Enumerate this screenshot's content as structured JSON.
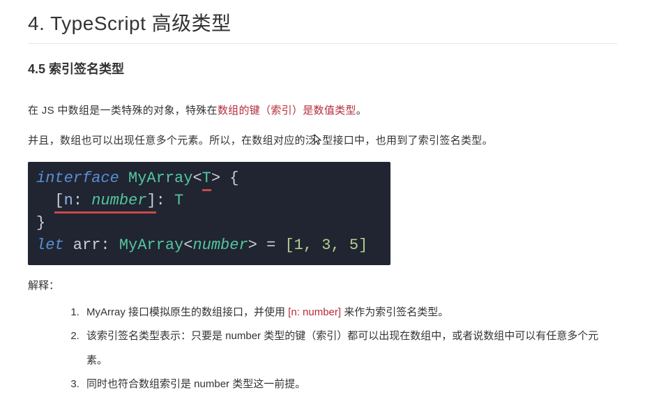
{
  "h1": "4. TypeScript 高级类型",
  "h2": "4.5 索引签名类型",
  "p1_a": "在 JS 中数组是一类特殊的对象，特殊在",
  "p1_em": "数组的键（索引）是数值类型",
  "p1_b": "。",
  "p2_a": "并且，数组也可以出现任意多个元素。所以，在数组对应的泛",
  "p2_b": "型接口中，也用到了索引签名类型。",
  "code": {
    "l1": {
      "kw": "interface",
      "name": "MyArray",
      "lt": "<",
      "tp": "T",
      "gt": ">",
      "brace": " {"
    },
    "l2": {
      "indent": "  ",
      "lb": "[",
      "k": "n",
      "colon1": ": ",
      "kt": "number",
      "rb": "]",
      "colon2": ": ",
      "vt": "T"
    },
    "l3": {
      "brace": "}"
    },
    "l4": {
      "kw": "let",
      "var": " arr",
      "colon": ": ",
      "t1": "MyArray",
      "lt": "<",
      "inner": "number",
      "gt": ">",
      "eq": " = ",
      "arr": "[1, 3, 5]"
    }
  },
  "explain_label": "解释：",
  "items": [
    {
      "a": "MyArray 接口模拟原生的数组接口，并使用 ",
      "code": "[n: number]",
      "b": " 来作为索引签名类型。"
    },
    {
      "a": "该索引签名类型表示：只要是 number 类型的键（索引）都可以出现在数组中，或者说数组中可以有任意多个元素。",
      "code": "",
      "b": ""
    },
    {
      "a": "同时也符合数组索引是 number 类型这一前提。",
      "code": "",
      "b": ""
    }
  ]
}
